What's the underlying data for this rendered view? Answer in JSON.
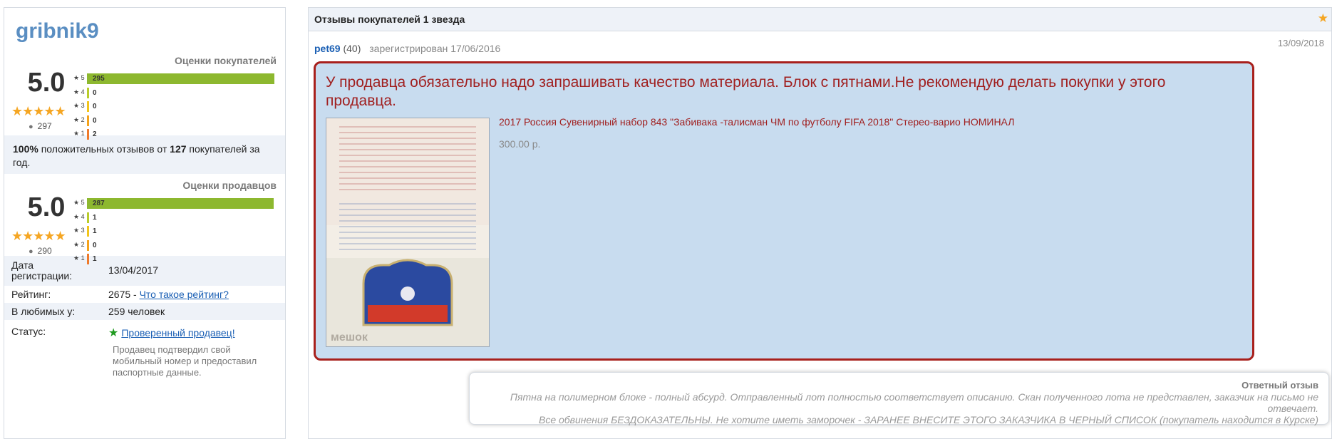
{
  "seller": {
    "name": "gribnik9"
  },
  "buyer_ratings": {
    "title": "Оценки покупателей",
    "score": "5.0",
    "stars": "★★★★★",
    "reviewers": "297",
    "rows": [
      {
        "label": "★ 5",
        "count": "295",
        "fraction": 0.993
      },
      {
        "label": "★ 4",
        "count": "0",
        "fraction": 0
      },
      {
        "label": "★ 3",
        "count": "0",
        "fraction": 0
      },
      {
        "label": "★ 2",
        "count": "0",
        "fraction": 0
      },
      {
        "label": "★ 1",
        "count": "2",
        "fraction": 0.007
      }
    ]
  },
  "positive": {
    "percent": "100%",
    "text_a": " положительных отзывов от ",
    "count": "127",
    "text_b": " покупателей за год."
  },
  "seller_ratings": {
    "title": "Оценки продавцов",
    "score": "5.0",
    "stars": "★★★★★",
    "reviewers": "290",
    "rows": [
      {
        "label": "★ 5",
        "count": "287",
        "fraction": 0.99
      },
      {
        "label": "★ 4",
        "count": "1",
        "fraction": 0.0035
      },
      {
        "label": "★ 3",
        "count": "1",
        "fraction": 0.0035
      },
      {
        "label": "★ 2",
        "count": "0",
        "fraction": 0
      },
      {
        "label": "★ 1",
        "count": "1",
        "fraction": 0.0035
      }
    ]
  },
  "info": {
    "reg_label": "Дата регистрации:",
    "reg_value": "13/04/2017",
    "rating_label": "Рейтинг:",
    "rating_value": "2675 - ",
    "rating_link": "Что такое рейтинг?",
    "fav_label": "В любимых у:",
    "fav_value": "259 человек",
    "status_label": "Статус:",
    "status_link": "Проверенный продавец!",
    "status_note": "Продавец подтвердил свой мобильный номер и предоставил паспортные данные."
  },
  "panel": {
    "title": "Отзывы покупателей 1 звезда",
    "star": "★"
  },
  "review": {
    "buyer_name": "pet69",
    "buyer_count": "(40)",
    "registered": "зарегистрирован 17/06/2016",
    "date": "13/09/2018",
    "text": "У продавца обязательно надо запрашивать качество материала. Блок с пятнами.Не рекомендую делать покупки у этого продавца.",
    "lot_title": "2017 Россия Сувенирный набор 843 \"Забивака -талисман ЧМ по футболу FIFA 2018\" Стерео-варио НОМИНАЛ",
    "lot_price": "300.00  р.",
    "thumb_watermark": "мешок"
  },
  "answer": {
    "title": "Ответный отзыв",
    "line1": "Пятна на полимерном блоке - полный абсурд. Отправленный лот полностью соответствует описанию. Скан полученного лота не представлен, заказчик на письмо не отвечает.",
    "line2": "Все обвинения БЕЗДОКАЗАТЕЛЬНЫ. Не хотите иметь заморочек - ЗАРАНЕЕ ВНЕСИТЕ ЭТОГО ЗАКАЗЧИКА В ЧЕРНЫЙ СПИСОК (покупатель находится в Курске)"
  },
  "colors": {
    "accent_blue": "#5a8ec2",
    "star_orange": "#f5a623",
    "review_red": "#a8201c",
    "review_bg": "#c8dcef",
    "verified_green": "#1f9a1f"
  }
}
